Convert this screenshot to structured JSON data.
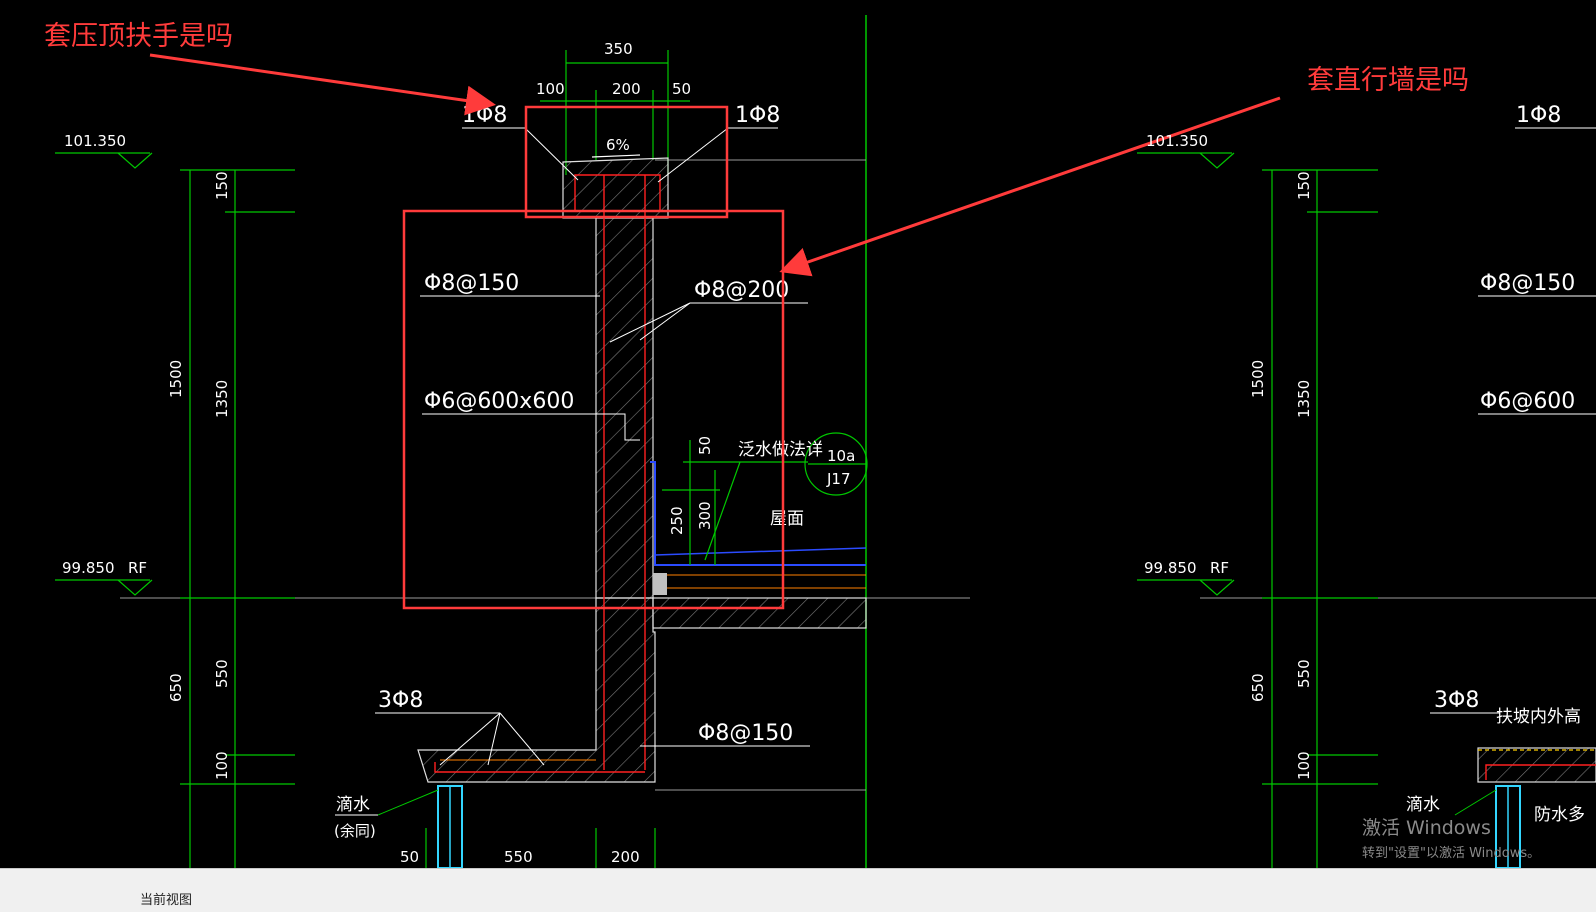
{
  "annotations": {
    "left_question": "套压顶扶手是吗",
    "right_question": "套直行墙是吗"
  },
  "drawing": {
    "elev_top": "101.350",
    "elev_rf": "99.850",
    "rf_label": "RF",
    "dims": {
      "d350": "350",
      "d100": "100",
      "d200": "200",
      "d50": "50",
      "d150": "150",
      "d1500": "1500",
      "d1350": "1350",
      "d650": "650",
      "d550": "550",
      "d100b": "100",
      "d300": "300",
      "d250": "250",
      "d50v": "50",
      "b50": "50",
      "b550": "550",
      "b200": "200"
    },
    "slope": "6%",
    "rebar": {
      "top_left": "1Φ8",
      "top_right": "1Φ8",
      "s150": "Φ8@150",
      "s200": "Φ8@200",
      "s600": "Φ6@600x600",
      "bottom": "3Φ8",
      "s150b": "Φ8@150"
    },
    "flash_note": "泛水做法详",
    "detail_top": "10a",
    "detail_bottom": "J17",
    "roof": "屋面",
    "drip": "滴水",
    "drip_sub": "(余同)",
    "right_top_rebar": "1Φ8",
    "right_s150": "Φ8@150",
    "right_s600": "Φ6@600",
    "right_bottom": "3Φ8",
    "right_note": "扶坡内外高",
    "right_waterproof": "防水多"
  },
  "watermark": {
    "line1": "激活 Windows",
    "line2": "转到\"设置\"以激活 Windows。"
  },
  "status": {
    "text": "当前视图"
  },
  "colors": {
    "annotation_red": "#ff3b3b",
    "cad_green": "#00c800",
    "hatch_gray": "#8c8c8c",
    "rebar_red": "#ff2020",
    "waterproof_blue": "#2b4bff"
  }
}
